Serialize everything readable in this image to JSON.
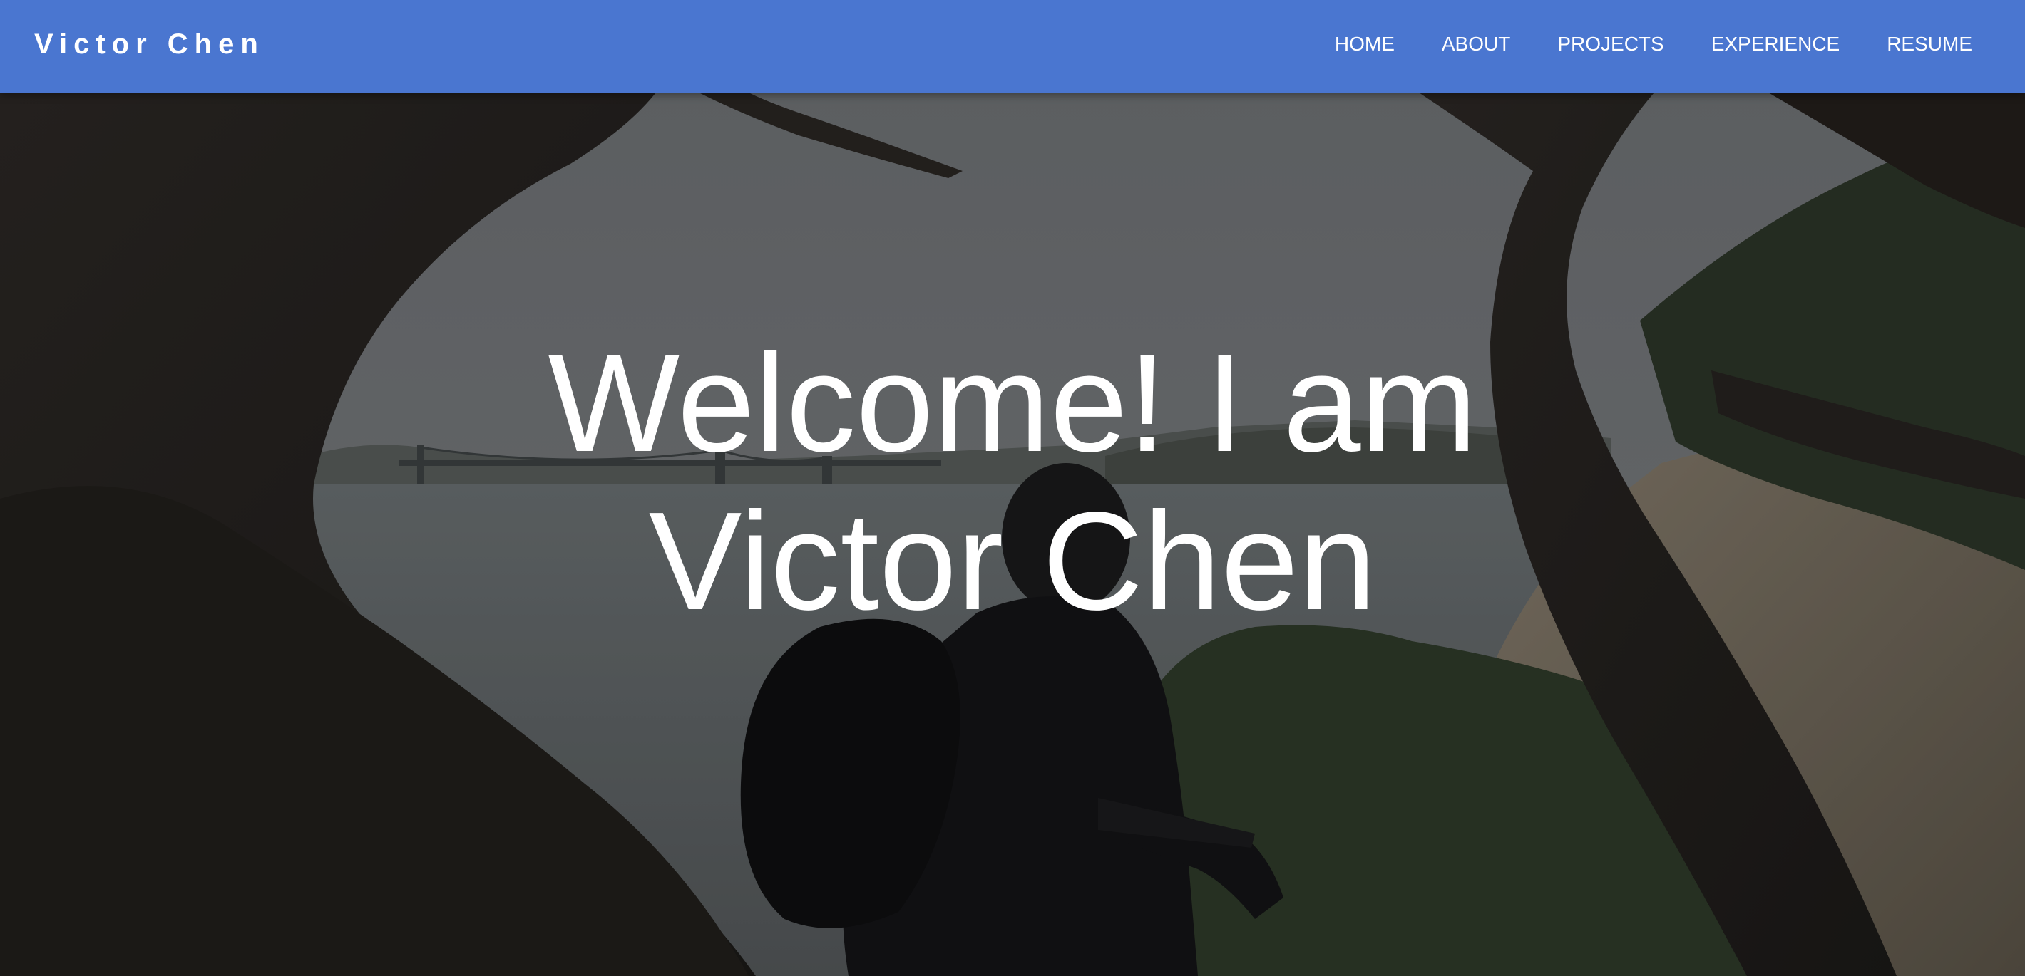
{
  "navbar": {
    "brand": "Victor Chen",
    "links": [
      {
        "label": "HOME"
      },
      {
        "label": "ABOUT"
      },
      {
        "label": "PROJECTS"
      },
      {
        "label": "EXPERIENCE"
      },
      {
        "label": "RESUME"
      }
    ],
    "background_color": "#4a76d0"
  },
  "hero": {
    "title_line1": "Welcome! I am",
    "title_line2": "Victor Chen",
    "background_image": "photo-of-person-sitting-under-cypress-trees-overlooking-bay-and-bridge"
  }
}
